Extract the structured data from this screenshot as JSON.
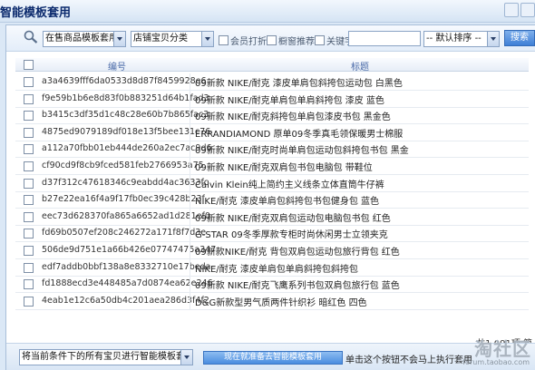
{
  "window": {
    "title": "智能模板套用"
  },
  "toolbar": {
    "template_filter": "在售商品模板套用",
    "category_filter": "店铺宝贝分类",
    "member_discount_label": "会员打折",
    "window_recommend_label": "橱窗推荐",
    "keyword_label": "关键字",
    "keyword_value": "",
    "sort_select": "-- 默认排序 --",
    "search_button": "搜索"
  },
  "grid": {
    "columns": [
      "编号",
      "标题"
    ],
    "rows": [
      {
        "id": "a3a4639fff6da0533d8d87f8459928e6",
        "title": "09新款 NIKE/耐克  漆皮单肩包斜挎包运动包  白黑色"
      },
      {
        "id": "f9e59b1b6e8d83f0b883251d64b1fad3",
        "title": "09新款 NIKE/耐克单肩包单肩斜挎包  漆皮  蓝色"
      },
      {
        "id": "b3415c3df35d1c48c28e60b7b865fac3",
        "title": "09新款 NIKE/耐克斜挎包单肩包漆皮书包  黑金色"
      },
      {
        "id": "4875ed9079189df018e13f5bee131c76",
        "title": "ERRANDIAMOND 原单09冬季真毛领保暖男士棉服"
      },
      {
        "id": "a112a70fbb01eb444de260a2ec7ac9d6",
        "title": "09新款 NIKE/耐克时尚单肩包运动包斜挎包书包  黑金"
      },
      {
        "id": "cf90cd9f8cb9fced581feb2766953a75",
        "title": "09新款 NIKE/耐克双肩包书包电脑包  带鞋位"
      },
      {
        "id": "d37f312c47618346c9eabdd4ac3633fc",
        "title": "Calvin Klein纯上简约主义线条立体直筒牛仔裤"
      },
      {
        "id": "b27e22ea16f4a9f17fb0ec39c428b23f",
        "title": "NIKE/耐克  漆皮单肩包斜挎包书包健身包  蓝色"
      },
      {
        "id": "eec73d628370fa865a6652ad1d281ef0",
        "title": "09新款 NIKE/耐克双肩包运动包电脑包书包  红色"
      },
      {
        "id": "fd69b0507ef208c246272a171f8f7d3e",
        "title": "G-STAR 09冬季厚款专柜时尚休闲男士立领夹克"
      },
      {
        "id": "506de9d751e1a66b426e07747475a347",
        "title": "09新款NIKE/耐克  背包双肩包运动包旅行背包  红色"
      },
      {
        "id": "edf7addb0bbf138a8e8332710e17beda",
        "title": "NIKE/耐克  漆皮单肩包单肩斜挎包斜挎包"
      },
      {
        "id": "fd1888ecd3e448485a7d0874ea62e246",
        "title": "09新款 NIKE/耐克飞鹰系列书包双肩包旅行包  蓝色"
      },
      {
        "id": "4eab1e12c6a50db4c201aea286d3f4f2",
        "title": "D&G新款型男气质两件针织衫  暗红色  四色"
      }
    ]
  },
  "footer": {
    "count_text": "共1,091项  第",
    "apply_scope": "将当前条件下的所有宝贝进行智能模板套用",
    "apply_button": "现在就准备去智能模板套用",
    "hint": "单击这个按钮不会马上执行套用"
  },
  "watermark": {
    "text": "淘社区",
    "url": "forum.taobao.com"
  }
}
